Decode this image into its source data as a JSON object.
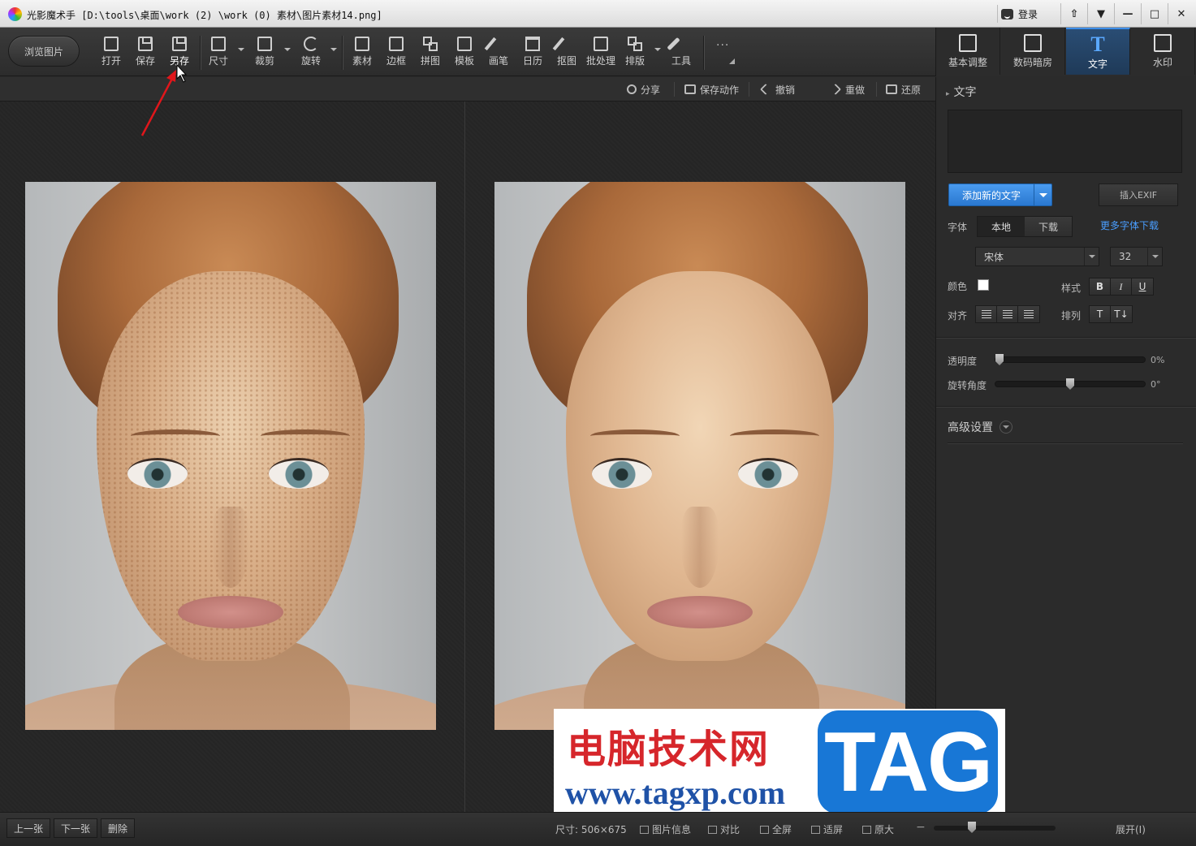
{
  "titlebar": {
    "title": "光影魔术手 [D:\\tools\\桌面\\work (2) \\work (0) 素材\\图片素材14.png]",
    "login_label": "登录",
    "buttons": [
      "⇧",
      "▼",
      "—",
      "□",
      "✕"
    ]
  },
  "toolbar": {
    "browse_label": "浏览图片",
    "tools": [
      {
        "label": "打开",
        "icon": "open-icon"
      },
      {
        "label": "保存",
        "icon": "save-icon"
      },
      {
        "label": "另存",
        "icon": "save-as-icon"
      },
      {
        "label": "尺寸",
        "icon": "resize-icon"
      },
      {
        "label": "裁剪",
        "icon": "crop-icon"
      },
      {
        "label": "旋转",
        "icon": "rotate-icon"
      },
      {
        "label": "素材",
        "icon": "material-icon"
      },
      {
        "label": "边框",
        "icon": "frame-icon"
      },
      {
        "label": "拼图",
        "icon": "collage-icon"
      },
      {
        "label": "模板",
        "icon": "template-icon"
      },
      {
        "label": "画笔",
        "icon": "brush-icon"
      },
      {
        "label": "日历",
        "icon": "calendar-icon"
      },
      {
        "label": "抠图",
        "icon": "cutout-icon"
      },
      {
        "label": "批处理",
        "icon": "batch-icon"
      },
      {
        "label": "排版",
        "icon": "layout-icon"
      },
      {
        "label": "工具",
        "icon": "wrench-icon"
      }
    ],
    "more_label": "···"
  },
  "actions": {
    "share": "分享",
    "save_action": "保存动作",
    "undo": "撤销",
    "redo": "重做",
    "restore": "还原"
  },
  "right_tabs": [
    {
      "label": "基本调整",
      "icon": "basic-adjust-icon"
    },
    {
      "label": "数码暗房",
      "icon": "darkroom-icon"
    },
    {
      "label": "文字",
      "icon": "text-icon"
    },
    {
      "label": "水印",
      "icon": "watermark-icon"
    }
  ],
  "text_panel": {
    "heading": "文字",
    "add_text_label": "添加新的文字",
    "insert_exif_label": "插入EXIF",
    "font_label": "字体",
    "font_tabs": [
      "本地",
      "下载"
    ],
    "more_fonts_link": "更多字体下载",
    "font_name": "宋体",
    "font_size": "32",
    "color_label": "颜色",
    "text_color": "#ffffff",
    "style_label": "样式",
    "style_buttons": [
      "B",
      "I",
      "U"
    ],
    "align_label": "对齐",
    "arrange_label": "排列",
    "opacity_label": "透明度",
    "opacity_value": "0%",
    "opacity_level": 0,
    "rotation_label": "旋转角度",
    "rotation_value": "0°",
    "rotation_level": 0.5,
    "advanced_label": "高级设置"
  },
  "status": {
    "prev": "上一张",
    "next": "下一张",
    "delete": "删除",
    "size": "尺寸: 506×675",
    "image_info": "图片信息",
    "compare": "对比",
    "fullscreen": "全屏",
    "fit": "适屏",
    "original": "原大",
    "expand": "展开(I)"
  },
  "watermark": {
    "cn_text": "电脑技术网",
    "url_text": "www.tagxp.com",
    "tag_text": "TAG"
  },
  "colors": {
    "accent": "#3d8eea",
    "link": "#4a9eff",
    "annotation_arrow": "#e0161b"
  }
}
